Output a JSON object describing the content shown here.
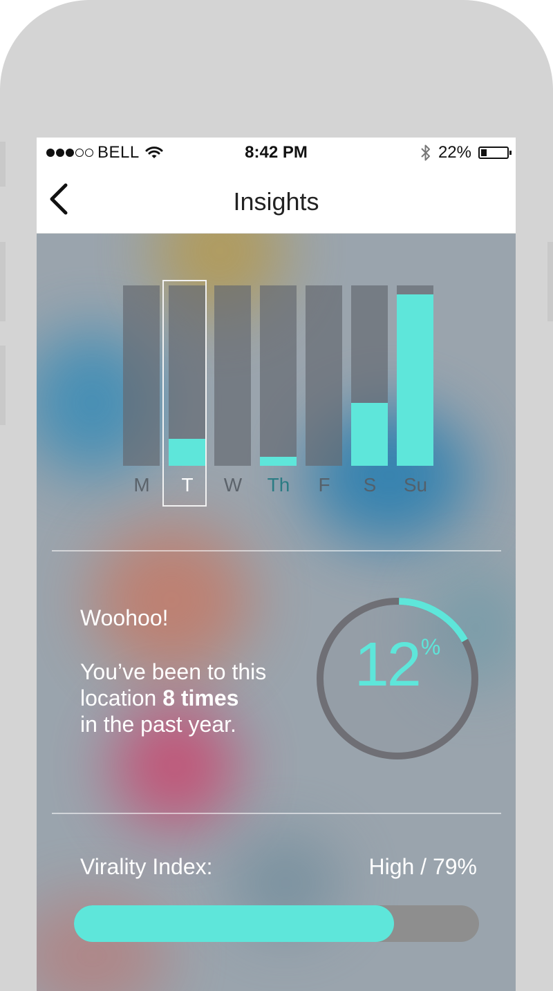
{
  "status_bar": {
    "signal_strength": 3,
    "signal_max": 5,
    "carrier": "BELL",
    "time": "8:42 PM",
    "battery": "22%",
    "battery_level": 0.22
  },
  "nav": {
    "title": "Insights",
    "back_icon": "chevron-left-icon"
  },
  "weekly_chart": {
    "days": [
      {
        "label": "M",
        "value": 0
      },
      {
        "label": "T",
        "value": 0.15,
        "selected": true
      },
      {
        "label": "W",
        "value": 0
      },
      {
        "label": "Th",
        "value": 0.05
      },
      {
        "label": "F",
        "value": 0
      },
      {
        "label": "S",
        "value": 0.35
      },
      {
        "label": "Su",
        "value": 0.95
      }
    ]
  },
  "visits": {
    "headline": "Woohoo!",
    "line1": "You’ve been to this",
    "line2_prefix": "location",
    "line2_bold": "8 times",
    "line3": "in the past year."
  },
  "percentage_gauge": {
    "value": 12,
    "unit": "%",
    "fill_fraction": 0.12
  },
  "virality": {
    "label": "Virality Index:",
    "value_text": "High / 79%",
    "progress_percent": 79
  },
  "colors": {
    "accent": "#5ee6da",
    "track": "#8e8e8e",
    "ring": "#6f6f75",
    "background": "#9aa4ad"
  }
}
